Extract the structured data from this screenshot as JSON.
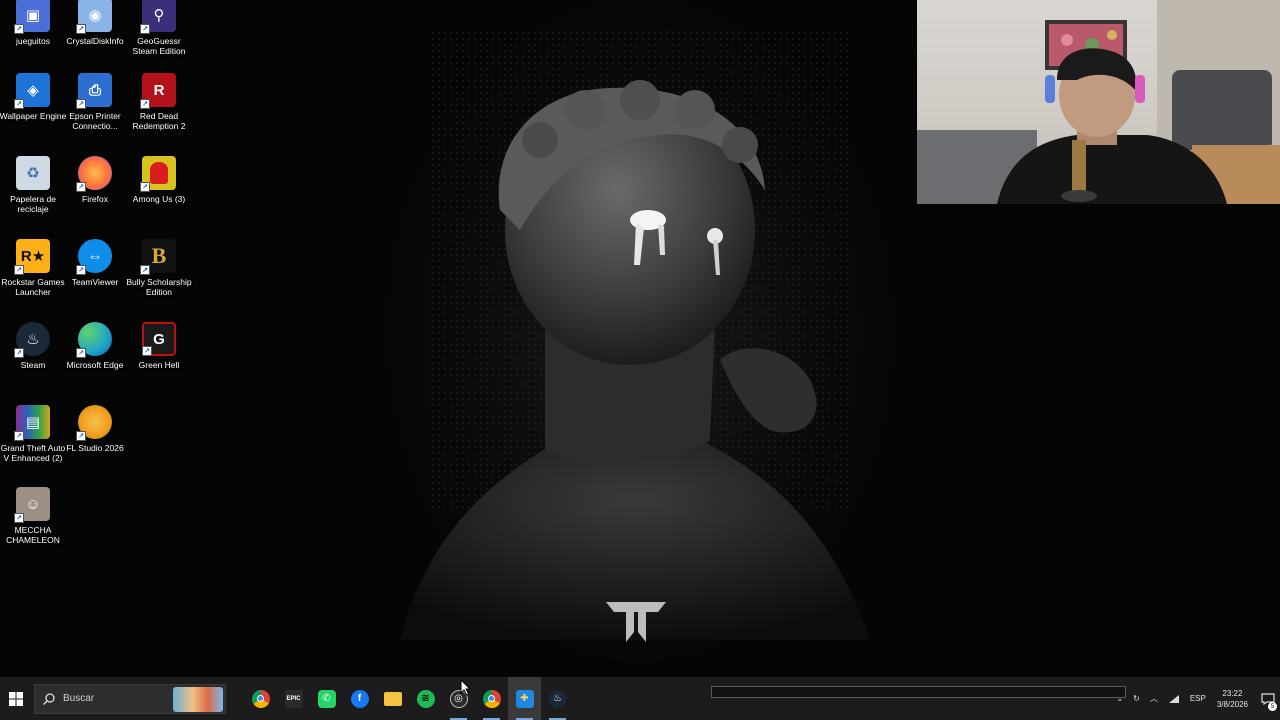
{
  "desktop": {
    "icons": [
      {
        "label": "jueguitos",
        "icon": "folder-icon",
        "color": "#4b6fd6"
      },
      {
        "label": "CrystalDiskInfo",
        "icon": "disk-icon",
        "color": "#8ab4e8"
      },
      {
        "label": "GeoGuessr Steam Edition",
        "icon": "map-pin-icon",
        "color": "#3b2f7a"
      },
      {
        "label": "Wallpaper Engine",
        "icon": "wallpaper-engine-icon",
        "color": "#1e74d6"
      },
      {
        "label": "Epson Printer Connectio...",
        "icon": "printer-icon",
        "color": "#2d6fd1"
      },
      {
        "label": "Red Dead Redemption 2",
        "icon": "rdr2-icon",
        "color": "#b3121b"
      },
      {
        "label": "Papelera de reciclaje",
        "icon": "recycle-bin-icon",
        "color": "#cfd8e3"
      },
      {
        "label": "Firefox",
        "icon": "firefox-icon",
        "color": "#ff7139"
      },
      {
        "label": "Among Us (3)",
        "icon": "among-us-icon",
        "color": "#d81e1e"
      },
      {
        "label": "Rockstar Games Launcher",
        "icon": "rockstar-icon",
        "color": "#fcaf17"
      },
      {
        "label": "TeamViewer",
        "icon": "teamviewer-icon",
        "color": "#0e8ee9"
      },
      {
        "label": "Bully Scholarship Edition",
        "icon": "bully-icon",
        "color": "#111111"
      },
      {
        "label": "Steam",
        "icon": "steam-icon",
        "color": "#1b2838"
      },
      {
        "label": "Microsoft Edge",
        "icon": "edge-icon",
        "color": "#1fa4c8"
      },
      {
        "label": "Green Hell",
        "icon": "green-hell-icon",
        "color": "#1a1a1a"
      },
      {
        "label": "Grand Theft Auto V Enhanced (2)",
        "icon": "winrar-icon",
        "color": "#8b2d8f"
      },
      {
        "label": "FL Studio 2026",
        "icon": "fl-studio-icon",
        "color": "#f29b1d"
      },
      {
        "label": "MECCHA CHAMELEON",
        "icon": "meccha-chameleon-icon",
        "color": "#9c8f86"
      }
    ]
  },
  "taskbar": {
    "search_placeholder": "Buscar",
    "apps": [
      {
        "name": "chrome",
        "icon": "chrome-icon",
        "glyph": "",
        "color": "#db4437"
      },
      {
        "name": "epic-games",
        "icon": "epic-games-icon",
        "glyph": "EPIC",
        "color": "#2a2a2a"
      },
      {
        "name": "whatsapp",
        "icon": "whatsapp-icon",
        "glyph": "✆",
        "color": "#25d366"
      },
      {
        "name": "facebook",
        "icon": "facebook-icon",
        "glyph": "f",
        "color": "#1877f2"
      },
      {
        "name": "file-explorer",
        "icon": "folder-icon",
        "glyph": "",
        "color": "#f5c342"
      },
      {
        "name": "spotify",
        "icon": "spotify-icon",
        "glyph": "≋",
        "color": "#1db954"
      },
      {
        "name": "obs",
        "icon": "obs-icon",
        "glyph": "◎",
        "color": "#2a2a2a"
      },
      {
        "name": "chrome-2",
        "icon": "chrome-icon",
        "glyph": "",
        "color": "#db4437"
      },
      {
        "name": "app-active",
        "icon": "shield-icon",
        "glyph": "✚",
        "color": "#1e88e5"
      },
      {
        "name": "steam",
        "icon": "steam-icon",
        "glyph": "♨",
        "color": "#1b2838"
      }
    ],
    "tray": {
      "language": "ESP",
      "time": "23:22",
      "date": "3/8/2026",
      "notification_count": "5"
    }
  }
}
